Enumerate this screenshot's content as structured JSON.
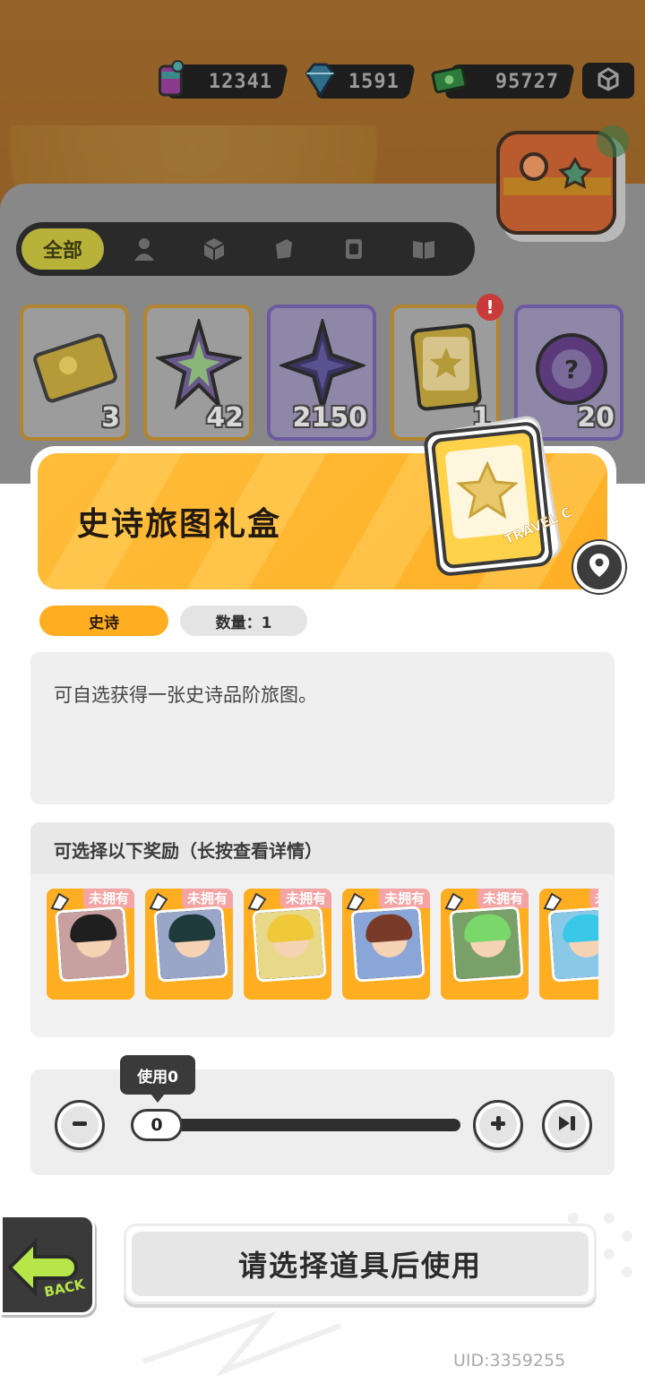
{
  "currencies": [
    {
      "icon": "soda-can-icon",
      "value": "12341"
    },
    {
      "icon": "diamond-icon",
      "value": "1591"
    },
    {
      "icon": "cash-icon",
      "value": "95727"
    }
  ],
  "menu_icon": "box-menu-icon",
  "badge_icon": "world-map-badge-icon",
  "tabs": {
    "active_label": "全部",
    "icons": [
      "person-icon",
      "box-icon",
      "ticket-icon",
      "card-icon",
      "book-icon"
    ]
  },
  "items": [
    {
      "icon": "ticket-item-icon",
      "count": "3",
      "frame": "gold"
    },
    {
      "icon": "rainbow-star-icon",
      "count": "42",
      "frame": "gold"
    },
    {
      "icon": "purple-star-icon",
      "count": "2150",
      "frame": "purple"
    },
    {
      "icon": "travel-card-icon",
      "count": "1",
      "frame": "gold",
      "alert": "!"
    },
    {
      "icon": "mystery-orb-icon",
      "count": "20",
      "frame": "purple"
    }
  ],
  "detail": {
    "title": "史诗旅图礼盒",
    "card_art_text": "TRAVEL CARD",
    "rarity": "史诗",
    "quantity_label": "数量：1",
    "description": "可自选获得一张史诗品阶旅图。"
  },
  "rewards": {
    "title": "可选择以下奖励（长按查看详情）",
    "cards": [
      {
        "status": "未拥有",
        "palette": "red"
      },
      {
        "status": "未拥有",
        "palette": "teal"
      },
      {
        "status": "未拥有",
        "palette": "yellow"
      },
      {
        "status": "未拥有",
        "palette": "blue"
      },
      {
        "status": "未拥有",
        "palette": "green"
      },
      {
        "status": "未拥",
        "palette": "cyan"
      }
    ]
  },
  "use": {
    "tooltip": "使用0",
    "value": "0",
    "fraction": 0
  },
  "back_label": "BACK",
  "main_button": "请选择道具后使用",
  "uid": "UID:3359255",
  "colors": {
    "accent_orange": "#ffae22",
    "dark": "#2e2e2e",
    "badge_pink": "#f4a4a4"
  }
}
